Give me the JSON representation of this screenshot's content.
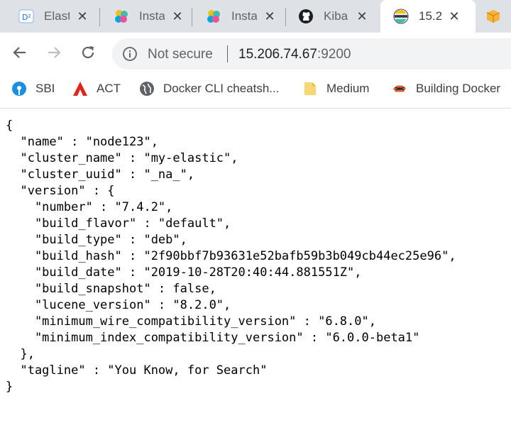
{
  "browser": {
    "tabs": [
      {
        "icon": "elastic-cloud-icon",
        "title": "Elast",
        "active": false
      },
      {
        "icon": "elastic-logo-icon",
        "title": "Insta",
        "active": false
      },
      {
        "icon": "elastic-logo-icon",
        "title": "Insta",
        "active": false
      },
      {
        "icon": "github-icon",
        "title": "Kiba",
        "active": false
      },
      {
        "icon": "elasticsearch-icon",
        "title": "15.2",
        "active": true
      }
    ],
    "address": {
      "security_text": "Not secure",
      "host": "15.206.74.67",
      "port": ":9200"
    },
    "bookmarks": [
      {
        "icon": "sbi-icon",
        "label": "SBI"
      },
      {
        "icon": "act-icon",
        "label": "ACT"
      },
      {
        "icon": "globe-icon",
        "label": "Docker CLI cheatsh..."
      },
      {
        "icon": "folder-icon",
        "label": "Medium"
      },
      {
        "icon": "docker-icon",
        "label": "Building Docker"
      }
    ],
    "colors": {
      "tabstrip": "#dee1e6",
      "omnibox": "#f1f3f4"
    }
  },
  "page": {
    "json_lines": [
      "{",
      "  \"name\" : \"node123\",",
      "  \"cluster_name\" : \"my-elastic\",",
      "  \"cluster_uuid\" : \"_na_\",",
      "  \"version\" : {",
      "    \"number\" : \"7.4.2\",",
      "    \"build_flavor\" : \"default\",",
      "    \"build_type\" : \"deb\",",
      "    \"build_hash\" : \"2f90bbf7b93631e52bafb59b3b049cb44ec25e96\",",
      "    \"build_date\" : \"2019-10-28T20:40:44.881551Z\",",
      "    \"build_snapshot\" : false,",
      "    \"lucene_version\" : \"8.2.0\",",
      "    \"minimum_wire_compatibility_version\" : \"6.8.0\",",
      "    \"minimum_index_compatibility_version\" : \"6.0.0-beta1\"",
      "  },",
      "  \"tagline\" : \"You Know, for Search\"",
      "}"
    ]
  }
}
